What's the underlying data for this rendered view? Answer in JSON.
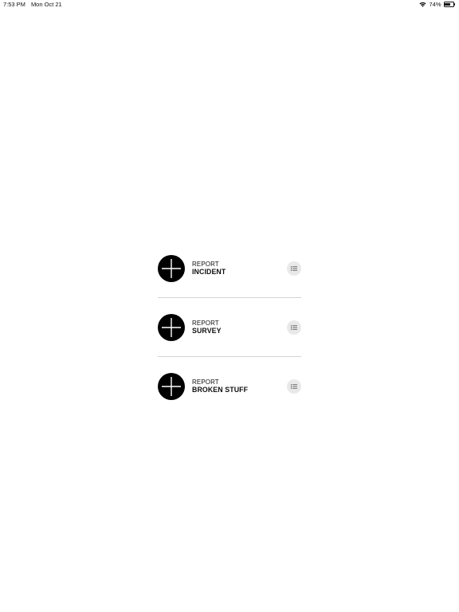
{
  "status_bar": {
    "time": "7:53 PM",
    "date": "Mon Oct 21",
    "battery_percent_label": "74%",
    "battery_level": 0.74,
    "icons": [
      "wifi-icon",
      "battery-icon"
    ]
  },
  "reports": [
    {
      "kicker": "REPORT",
      "title": "INCIDENT",
      "icons": [
        "plus-icon",
        "list-icon"
      ]
    },
    {
      "kicker": "REPORT",
      "title": "SURVEY",
      "icons": [
        "plus-icon",
        "list-icon"
      ]
    },
    {
      "kicker": "REPORT",
      "title": "BROKEN STUFF",
      "icons": [
        "plus-icon",
        "list-icon"
      ]
    }
  ],
  "colors": {
    "background": "#ffffff",
    "button_fill": "#000000",
    "list_button_fill": "#e9e9e9",
    "divider": "#d4d4d4",
    "text": "#111111"
  }
}
